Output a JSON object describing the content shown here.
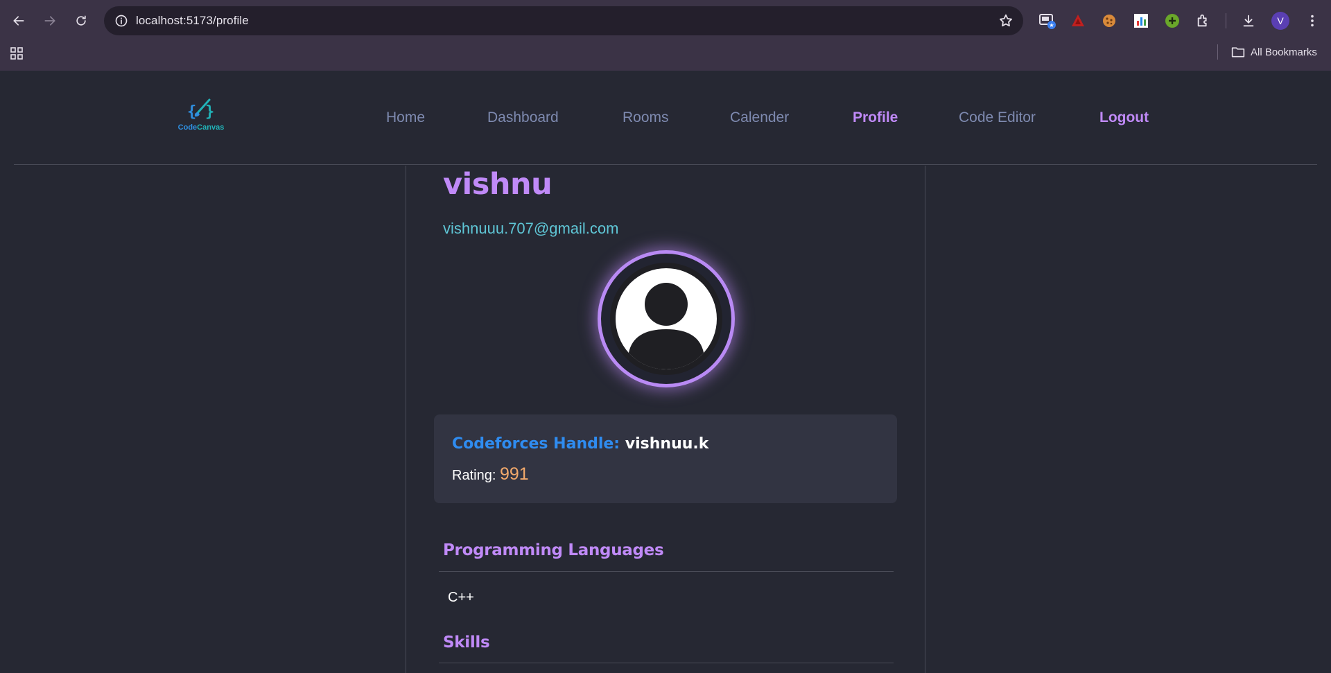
{
  "browser": {
    "url": "localhost:5173/profile",
    "bookmarks_folder": "All Bookmarks",
    "profile_initial": "V",
    "icons": [
      "back-icon",
      "forward-icon",
      "reload-icon",
      "site-info-icon",
      "bookmark-star-icon",
      "apps-grid-icon",
      "folder-icon",
      "download-icon",
      "extensions-icon",
      "menu-icon"
    ]
  },
  "site": {
    "logo_text_1": "Code",
    "logo_text_2": "Canvas",
    "nav": {
      "home": "Home",
      "dashboard": "Dashboard",
      "rooms": "Rooms",
      "calender": "Calender",
      "profile": "Profile",
      "code_editor": "Code Editor",
      "logout": "Logout"
    }
  },
  "profile": {
    "name": "vishnu",
    "email": "vishnuuu.707@gmail.com",
    "codeforces_label": "Codeforces Handle:",
    "codeforces_handle": "vishnuu.k",
    "rating_label": "Rating:",
    "rating_value": "991",
    "languages_title": "Programming Languages",
    "languages": [
      "C++"
    ],
    "skills_title": "Skills"
  },
  "colors": {
    "accent": "#c08af8",
    "email": "#5fc6d6",
    "handle_label": "#2f8cf0",
    "rating": "#f2a96b",
    "background": "#262833"
  }
}
